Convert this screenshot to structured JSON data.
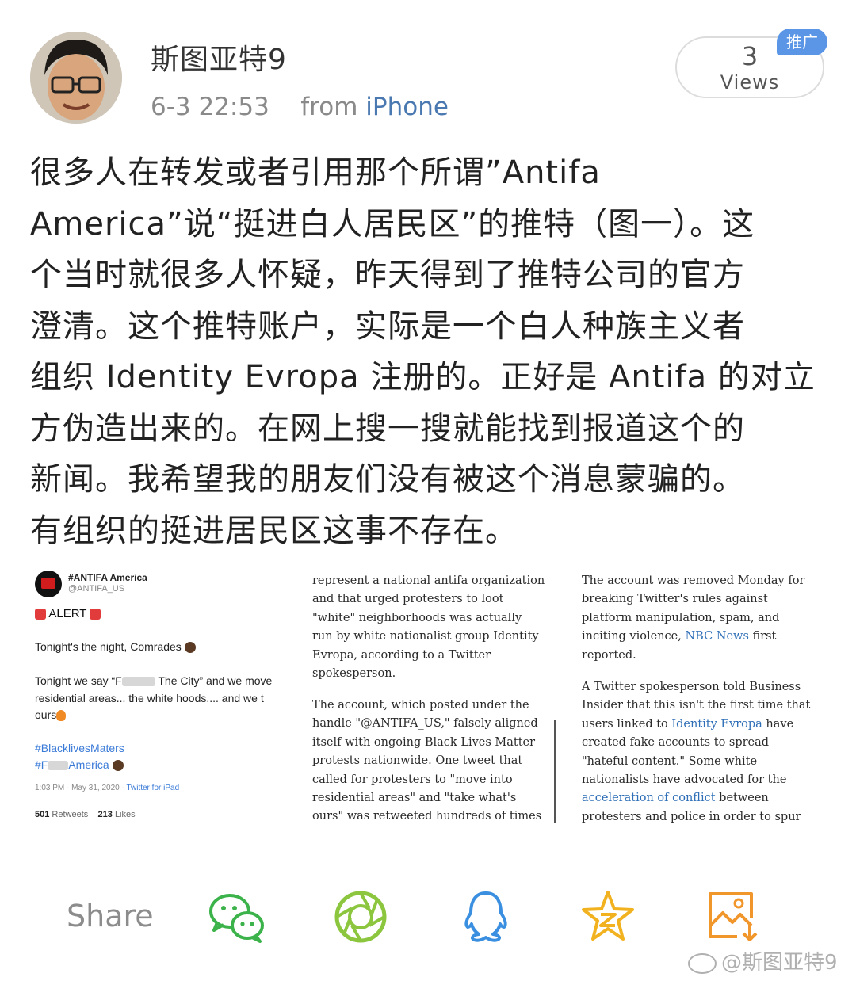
{
  "post": {
    "username": "斯图亚特9",
    "time": "6-3 22:53",
    "from_label": "from",
    "source": "iPhone",
    "views_count": "3",
    "views_label": "Views",
    "promo_badge": "推广",
    "text": "很多人在转发或者引用那个所谓”Antifa\nAmerica”说“挺进白人居民区”的推特（图一）。这\n个当时就很多人怀疑，昨天得到了推特公司的官方\n澄清。这个推特账户，实际是一个白人种族主义者\n组织 Identity Evropa 注册的。正好是 Antifa 的对立\n方伪造出来的。在网上搜一搜就能找到报道这个的\n新闻。我希望我的朋友们没有被这个消息蒙骗的。\n有组织的挺进居民区这事不存在。"
  },
  "embed": {
    "tweet": {
      "name": "#ANTIFA America",
      "handle": "@ANTIFA_US",
      "alert": "ALERT",
      "line1": "Tonight's the night, Comrades",
      "line2a": "Tonight we say “F",
      "line2b": " The City” and we move",
      "line3": "residential areas... the white hoods.... and we t",
      "line4": "ours",
      "tag1": "#BlacklivesMaters",
      "tag2a": "#F",
      "tag2b": "America",
      "date": "1:03 PM · May 31, 2020 · ",
      "via": "Twitter for iPad",
      "retweets_num": "501",
      "retweets_label": "Retweets",
      "likes_num": "213",
      "likes_label": "Likes"
    },
    "article_mid": {
      "para1": "represent a national antifa organization\nand that urged protesters to loot\n\"white\" neighborhoods was actually\nrun by white nationalist group Identity\nEvropa, according to a Twitter\nspokesperson.",
      "para2": "The account, which posted under the\nhandle \"@ANTIFA_US,\" falsely aligned\nitself with ongoing Black Lives Matter\nprotests nationwide. One tweet that\ncalled for protesters to \"move into\nresidential areas\" and \"take what's\nours\" was retweeted hundreds of times"
    },
    "article_right": {
      "p1a": "The account was removed Monday for\nbreaking Twitter's rules against\nplatform manipulation, spam, and\ninciting violence, ",
      "p1_link": "NBC News",
      "p1b": " first\nreported.",
      "p2a": "A Twitter spokesperson told Business\nInsider that this isn't the first time that\nusers linked to ",
      "p2_link1": "Identity Evropa",
      "p2b": " have\ncreated fake accounts to spread\n\"hateful content.\" Some white\nnationalists have advocated for the\n",
      "p2_link2": "acceleration of conflict",
      "p2c": " between\nprotesters and police in order to spur"
    }
  },
  "share": {
    "label": "Share",
    "icons": [
      "wechat-icon",
      "moments-icon",
      "qq-icon",
      "qzone-icon",
      "save-image-icon"
    ]
  },
  "watermark": "@斯图亚特9",
  "colors": {
    "link": "#4a78b0",
    "green": "#3cb34a",
    "qq_blue": "#3a8fe0",
    "star_yellow": "#f2b21f",
    "orange": "#f0962a",
    "promo": "#5a95e6"
  }
}
